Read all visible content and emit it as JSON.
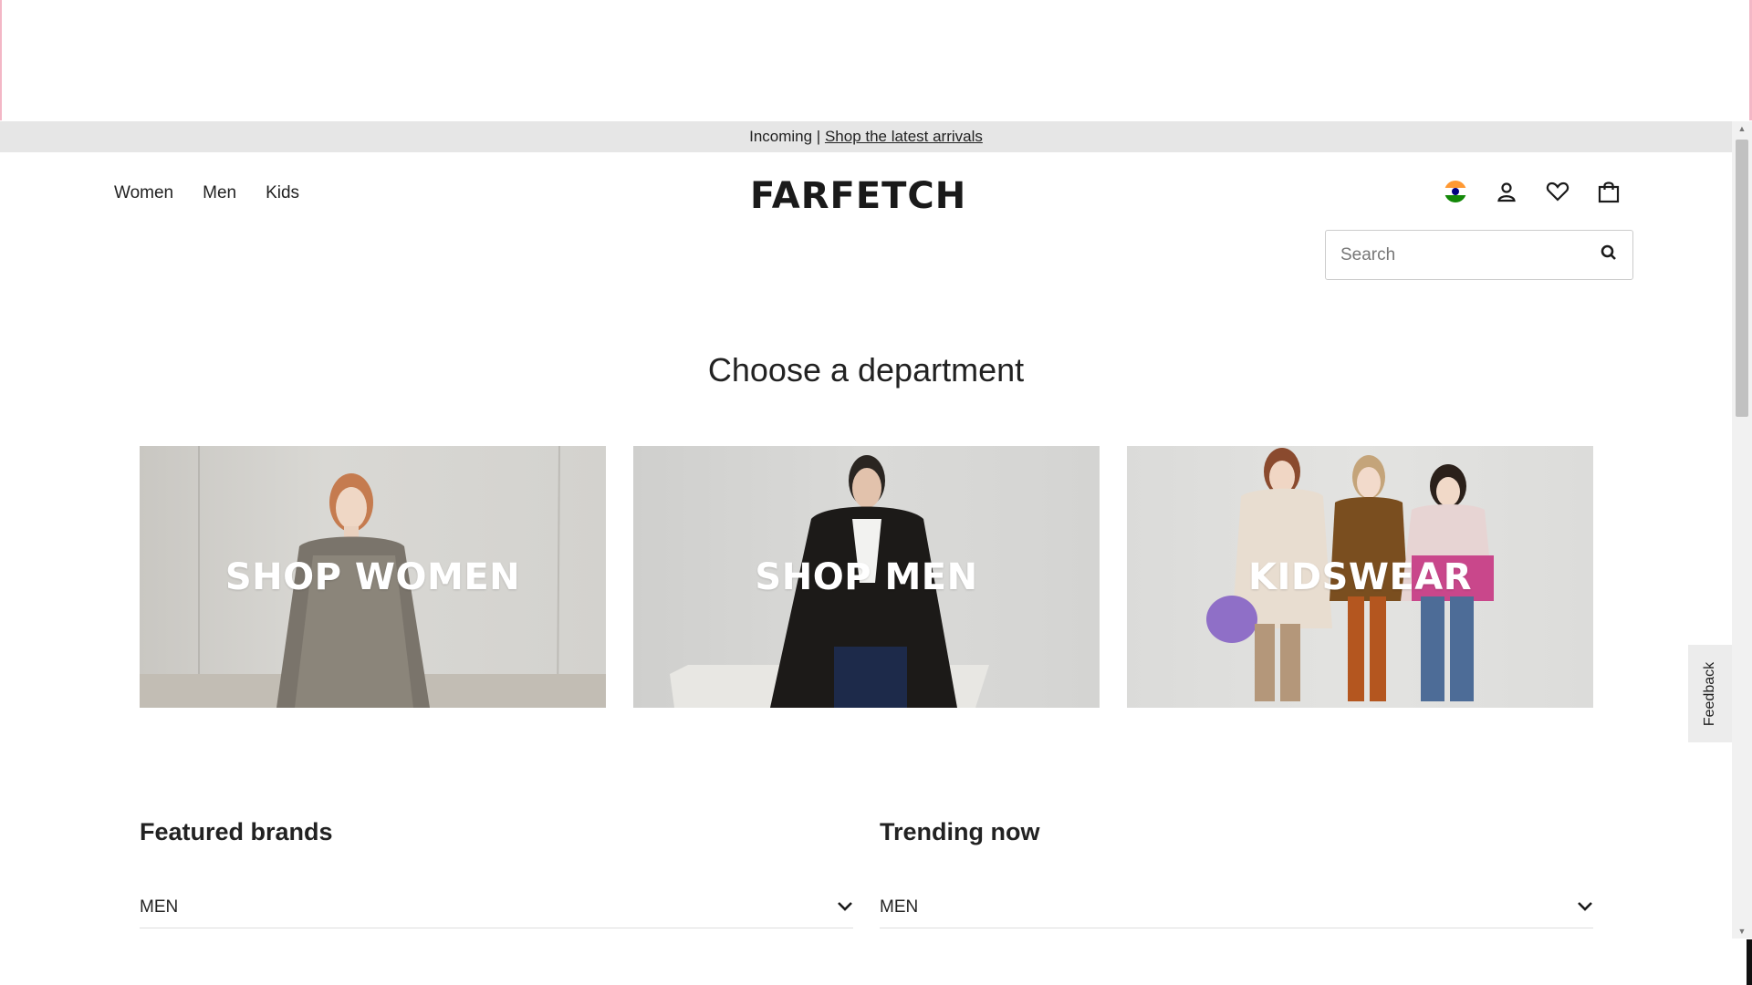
{
  "promo": {
    "prefix": "Incoming | ",
    "link": "Shop the latest arrivals"
  },
  "nav": {
    "items": [
      {
        "label": "Women"
      },
      {
        "label": "Men"
      },
      {
        "label": "Kids"
      }
    ]
  },
  "logo": "FARFETCH",
  "header_icons": [
    "india-flag-icon",
    "account-icon",
    "heart-icon",
    "bag-icon"
  ],
  "search": {
    "placeholder": "Search",
    "value": ""
  },
  "department": {
    "title": "Choose a department",
    "tiles": [
      {
        "label": "SHOP WOMEN"
      },
      {
        "label": "SHOP MEN"
      },
      {
        "label": "KIDSWEAR"
      }
    ]
  },
  "featured_brands": {
    "title": "Featured brands",
    "selected": "MEN"
  },
  "trending": {
    "title": "Trending now",
    "selected": "MEN"
  },
  "feedback_label": "Feedback",
  "colors": {
    "promo_bg": "#e6e6e6",
    "text": "#222222",
    "border": "#cccccc"
  }
}
